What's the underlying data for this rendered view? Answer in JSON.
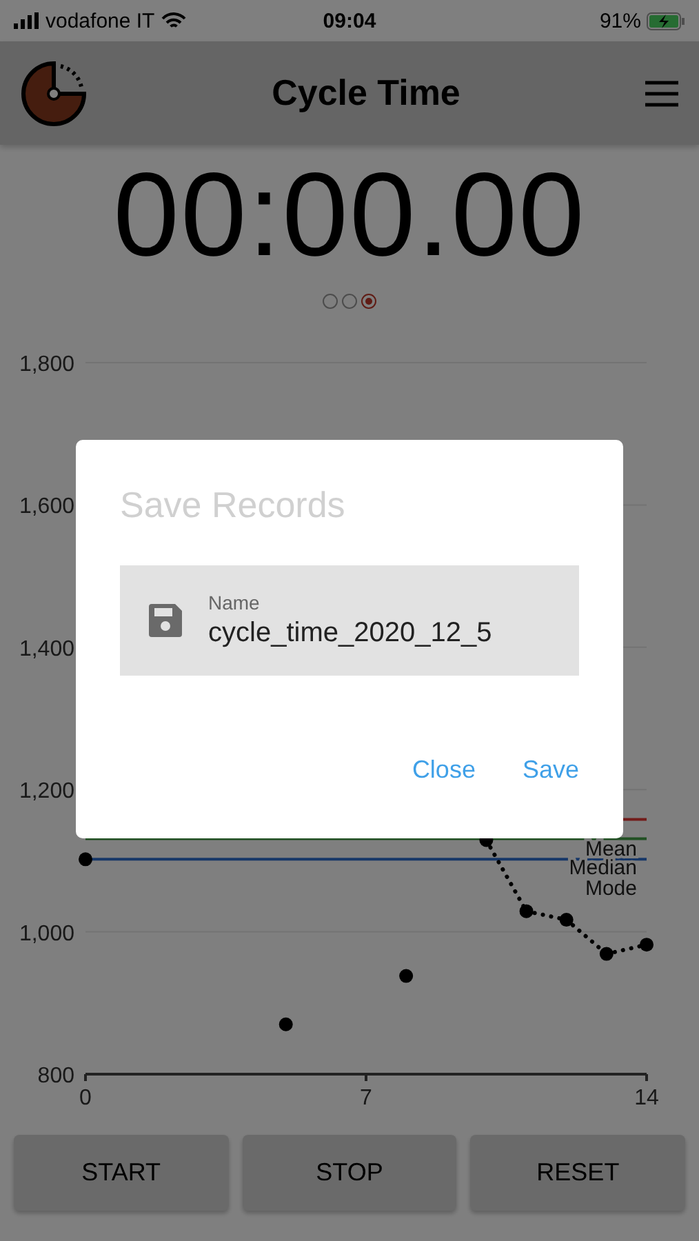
{
  "status_bar": {
    "carrier": "vodafone IT",
    "time": "09:04",
    "battery": "91%"
  },
  "header": {
    "title": "Cycle Time"
  },
  "timer": {
    "display": "00:00.00"
  },
  "pages": [
    {
      "selected": false
    },
    {
      "selected": false
    },
    {
      "selected": true
    }
  ],
  "chart": {
    "chart_data": {
      "type": "line",
      "x": [
        0,
        1,
        2,
        3,
        4,
        5,
        6,
        7,
        8,
        9,
        10,
        11,
        12,
        13,
        14
      ],
      "series": [
        {
          "color": "#000000",
          "line_style": "dotted",
          "marker": "circle",
          "values": [
            1102,
            null,
            null,
            null,
            null,
            870,
            null,
            null,
            938,
            null,
            1129,
            1029,
            1017,
            969,
            982
          ]
        }
      ],
      "xlim": [
        0,
        14
      ],
      "ylim": [
        800,
        1800
      ],
      "xticks": [
        0,
        7,
        14
      ],
      "grid": true,
      "yticks": [
        {
          "value": 800,
          "label": "800"
        },
        {
          "value": 1000,
          "label": "1,000"
        },
        {
          "value": 1200,
          "label": "1,200"
        },
        {
          "value": 1400,
          "label": "1,400"
        },
        {
          "value": 1600,
          "label": "1,600"
        },
        {
          "value": 1800,
          "label": "1,800"
        }
      ],
      "ref_lines": [
        {
          "axis": "y",
          "value": 1158,
          "color": "#e53935",
          "label": "Mean"
        },
        {
          "axis": "y",
          "value": 1131,
          "color": "#43a047",
          "label": "Median"
        },
        {
          "axis": "y",
          "value": 1102,
          "color": "#2f6fd0",
          "label": "Mode"
        }
      ]
    }
  },
  "buttons": [
    "START",
    "STOP",
    "RESET"
  ],
  "dialog": {
    "title": "Save Records",
    "field": {
      "label": "Name",
      "value": "cycle_time_2020_12_5"
    },
    "actions": [
      "Close",
      "Save"
    ]
  }
}
